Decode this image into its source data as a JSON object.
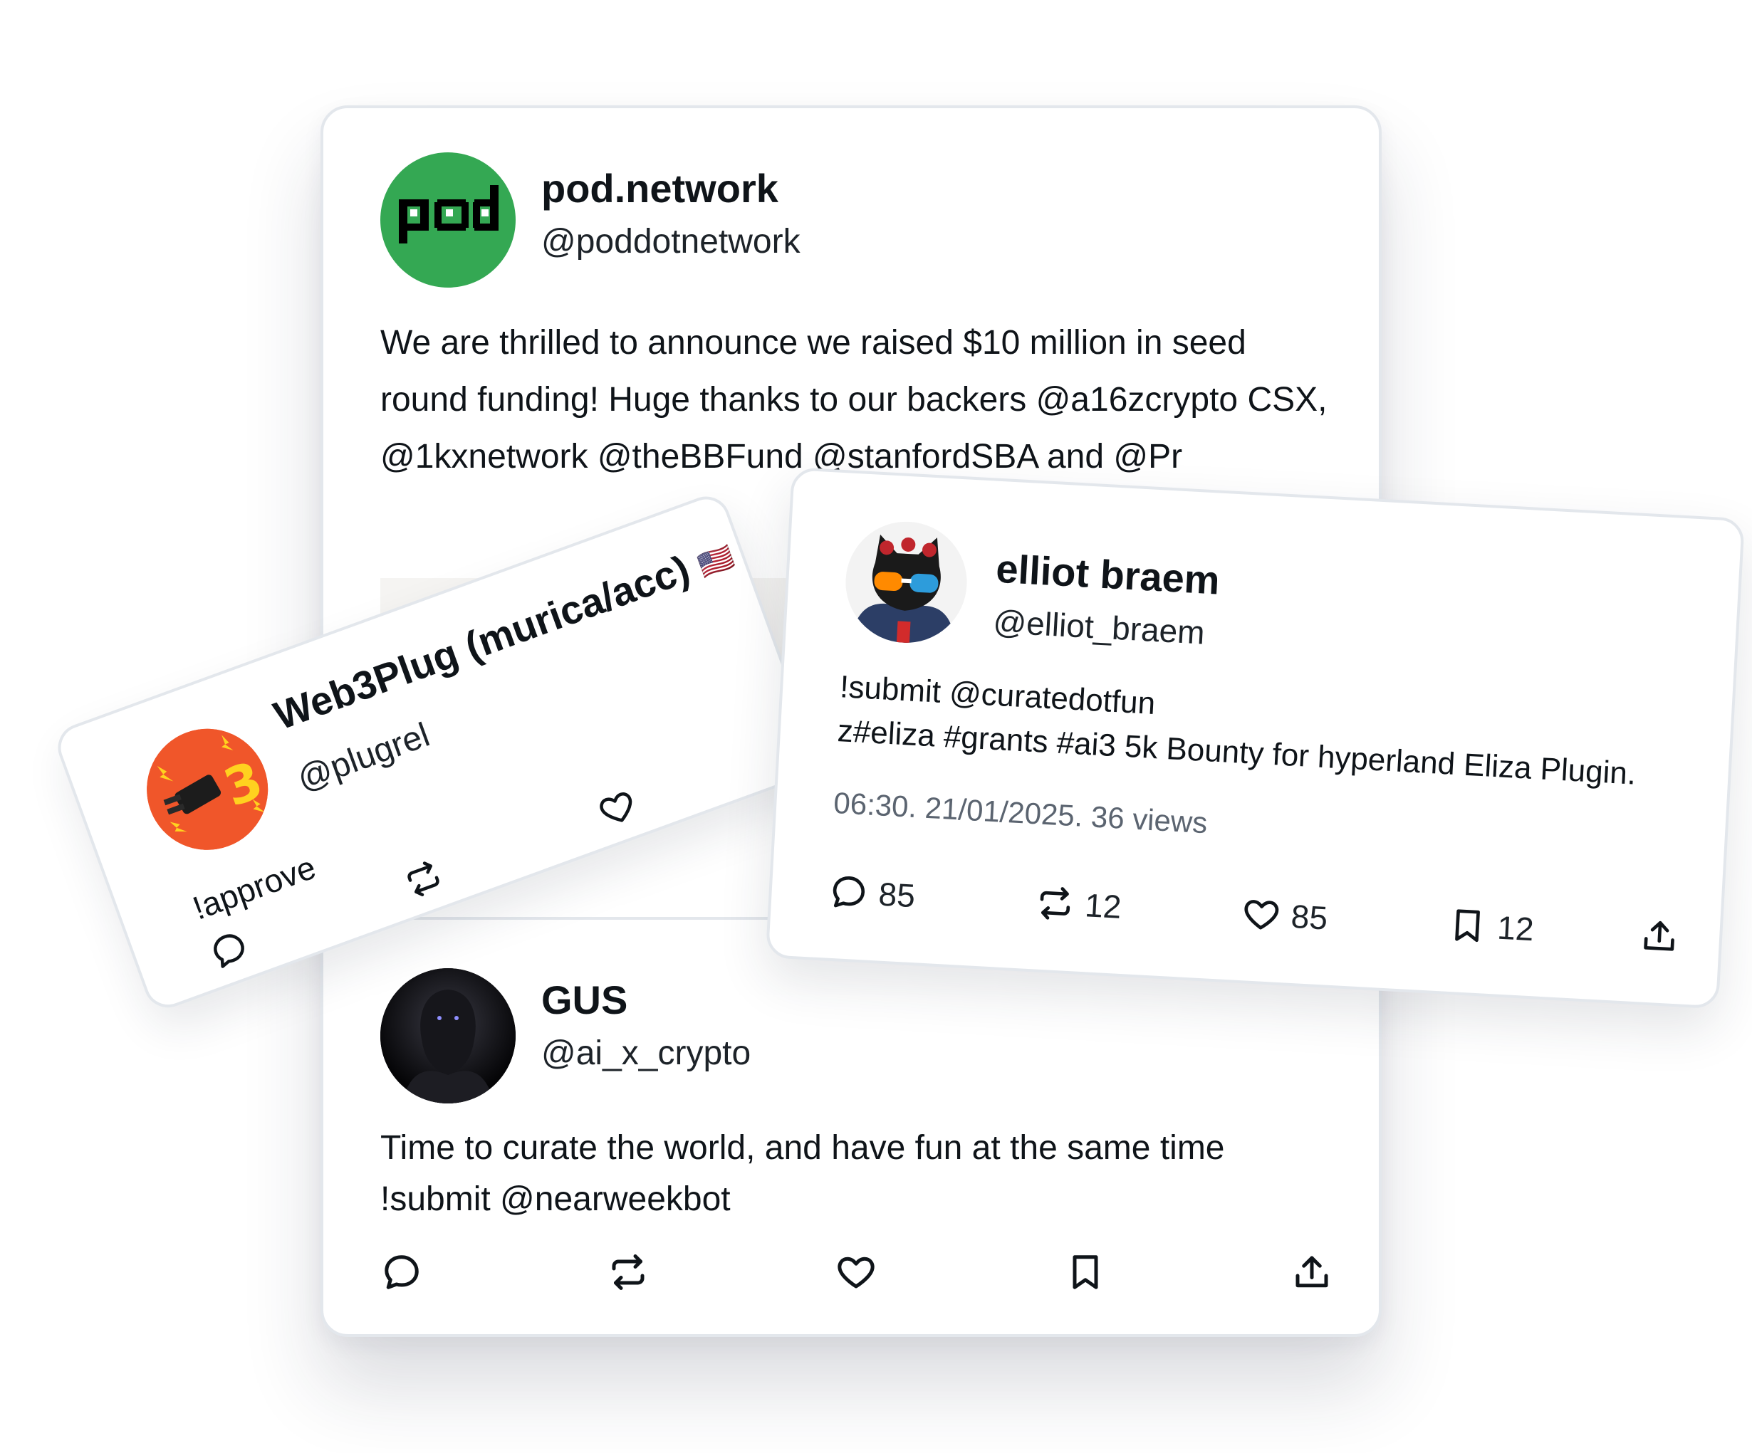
{
  "colors": {
    "pod_green": "#34a853",
    "border": "#e3e7ec",
    "text": "#0f1419",
    "muted": "#5b6470",
    "web3_orange": "#f0562a"
  },
  "main_post": {
    "avatar_text": "pod",
    "name": "pod.network",
    "handle": "@poddotnetwork",
    "text": "We are thrilled to announce we raised $10 million in seed round funding! Huge thanks to our backers @a16zcrypto CSX,  @1kxnetwork @theBBFund @stanfordSBA and  @Pr"
  },
  "gus_post": {
    "name": "GUS",
    "handle": "@ai_x_crypto",
    "text_line1": "Time to curate the world, and have fun at the same time",
    "text_line2": "!submit @nearweekbot",
    "actions": [
      "reply-icon",
      "retweet-icon",
      "like-icon",
      "bookmark-icon",
      "share-icon"
    ]
  },
  "web3_post": {
    "name": "Web3Plug (murica/acc)",
    "flag": "🇺🇸",
    "handle": "@plugrel",
    "text": "!approve",
    "avatar_badge": "3"
  },
  "elliot_post": {
    "name": "elliot braem",
    "handle": "@elliot_braem",
    "text_line1": "!submit @curatedotfun",
    "text_line2": "z#eliza #grants #ai3 5k Bounty for hyperland Eliza Plugin.",
    "meta": "06:30. 21/01/2025. 36 views",
    "counts": {
      "replies": "85",
      "retweets": "12",
      "likes": "85",
      "bookmarks": "12"
    }
  }
}
